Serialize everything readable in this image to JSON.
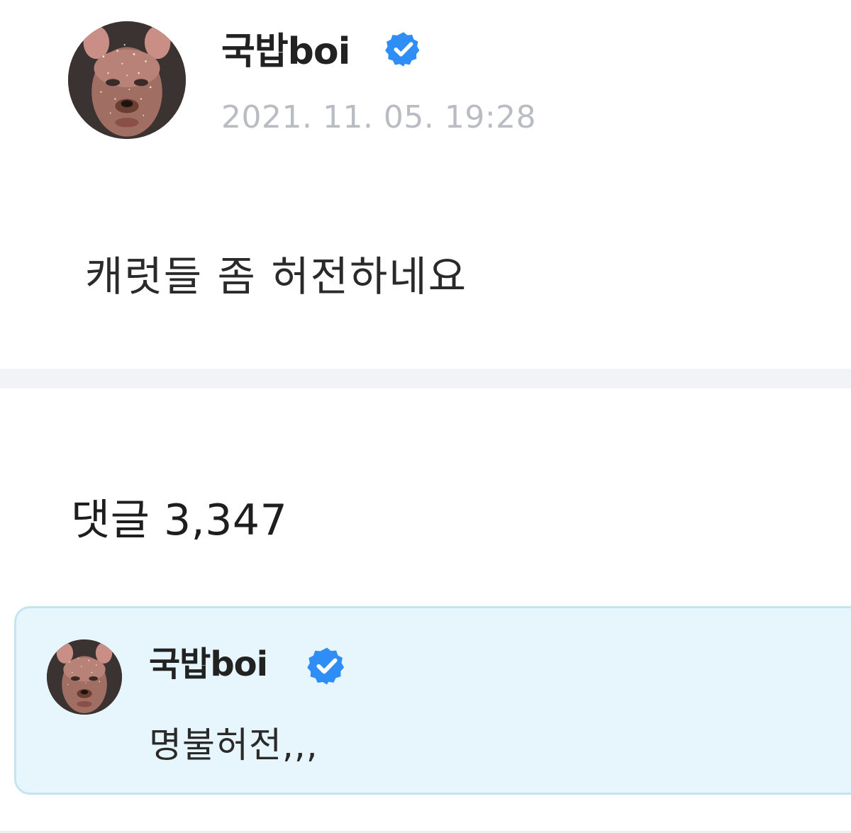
{
  "post": {
    "author": "국밥boi",
    "timestamp": "2021. 11. 05. 19:28",
    "body": "캐럿들 좀 허전하네요",
    "avatar_icon": "avatar-puppy-filter",
    "verified_icon": "verified-badge-icon"
  },
  "comments": {
    "count_label": "댓글 3,347",
    "items": [
      {
        "author": "국밥boi",
        "text": "명불허전,,,",
        "highlighted": true
      }
    ]
  },
  "colors": {
    "verified": "#2f8ef5",
    "timestamp": "#b9bcc2",
    "highlight_bg": "#e6f6fc",
    "highlight_border": "#c6e4ef",
    "divider": "#f1f3f6"
  }
}
